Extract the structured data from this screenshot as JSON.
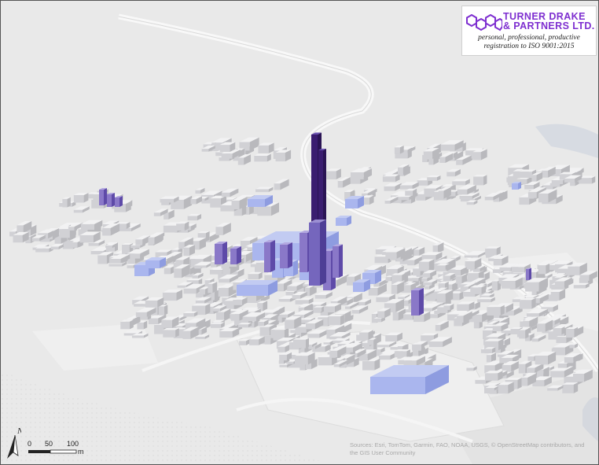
{
  "logo": {
    "company_line1": "Turner Drake",
    "company_line2": "& Partners Ltd.",
    "tagline1": "personal, professional, productive",
    "tagline2": "registration to ISO 9001:2015"
  },
  "scale": {
    "labels": [
      "0",
      "50",
      "100"
    ],
    "unit": "m"
  },
  "north_arrow": {
    "label": "N"
  },
  "attribution": "Sources: Esri, TomTom, Garmin, FAO, NOAA, USGS, © OpenStreetMap contributors, and the GIS User Community",
  "colors": {
    "ground": "#e9e9e9",
    "road": "#f7f7f7",
    "building_light": "#c9c9cd",
    "highlight_blue": "#a9b6ee",
    "highlight_violet": "#8a78c8",
    "tower_dark": "#3a1d70",
    "logo_purple": "#7e2fd0"
  },
  "icons": [
    "north-arrow-icon",
    "hexagon-logo-icon"
  ]
}
